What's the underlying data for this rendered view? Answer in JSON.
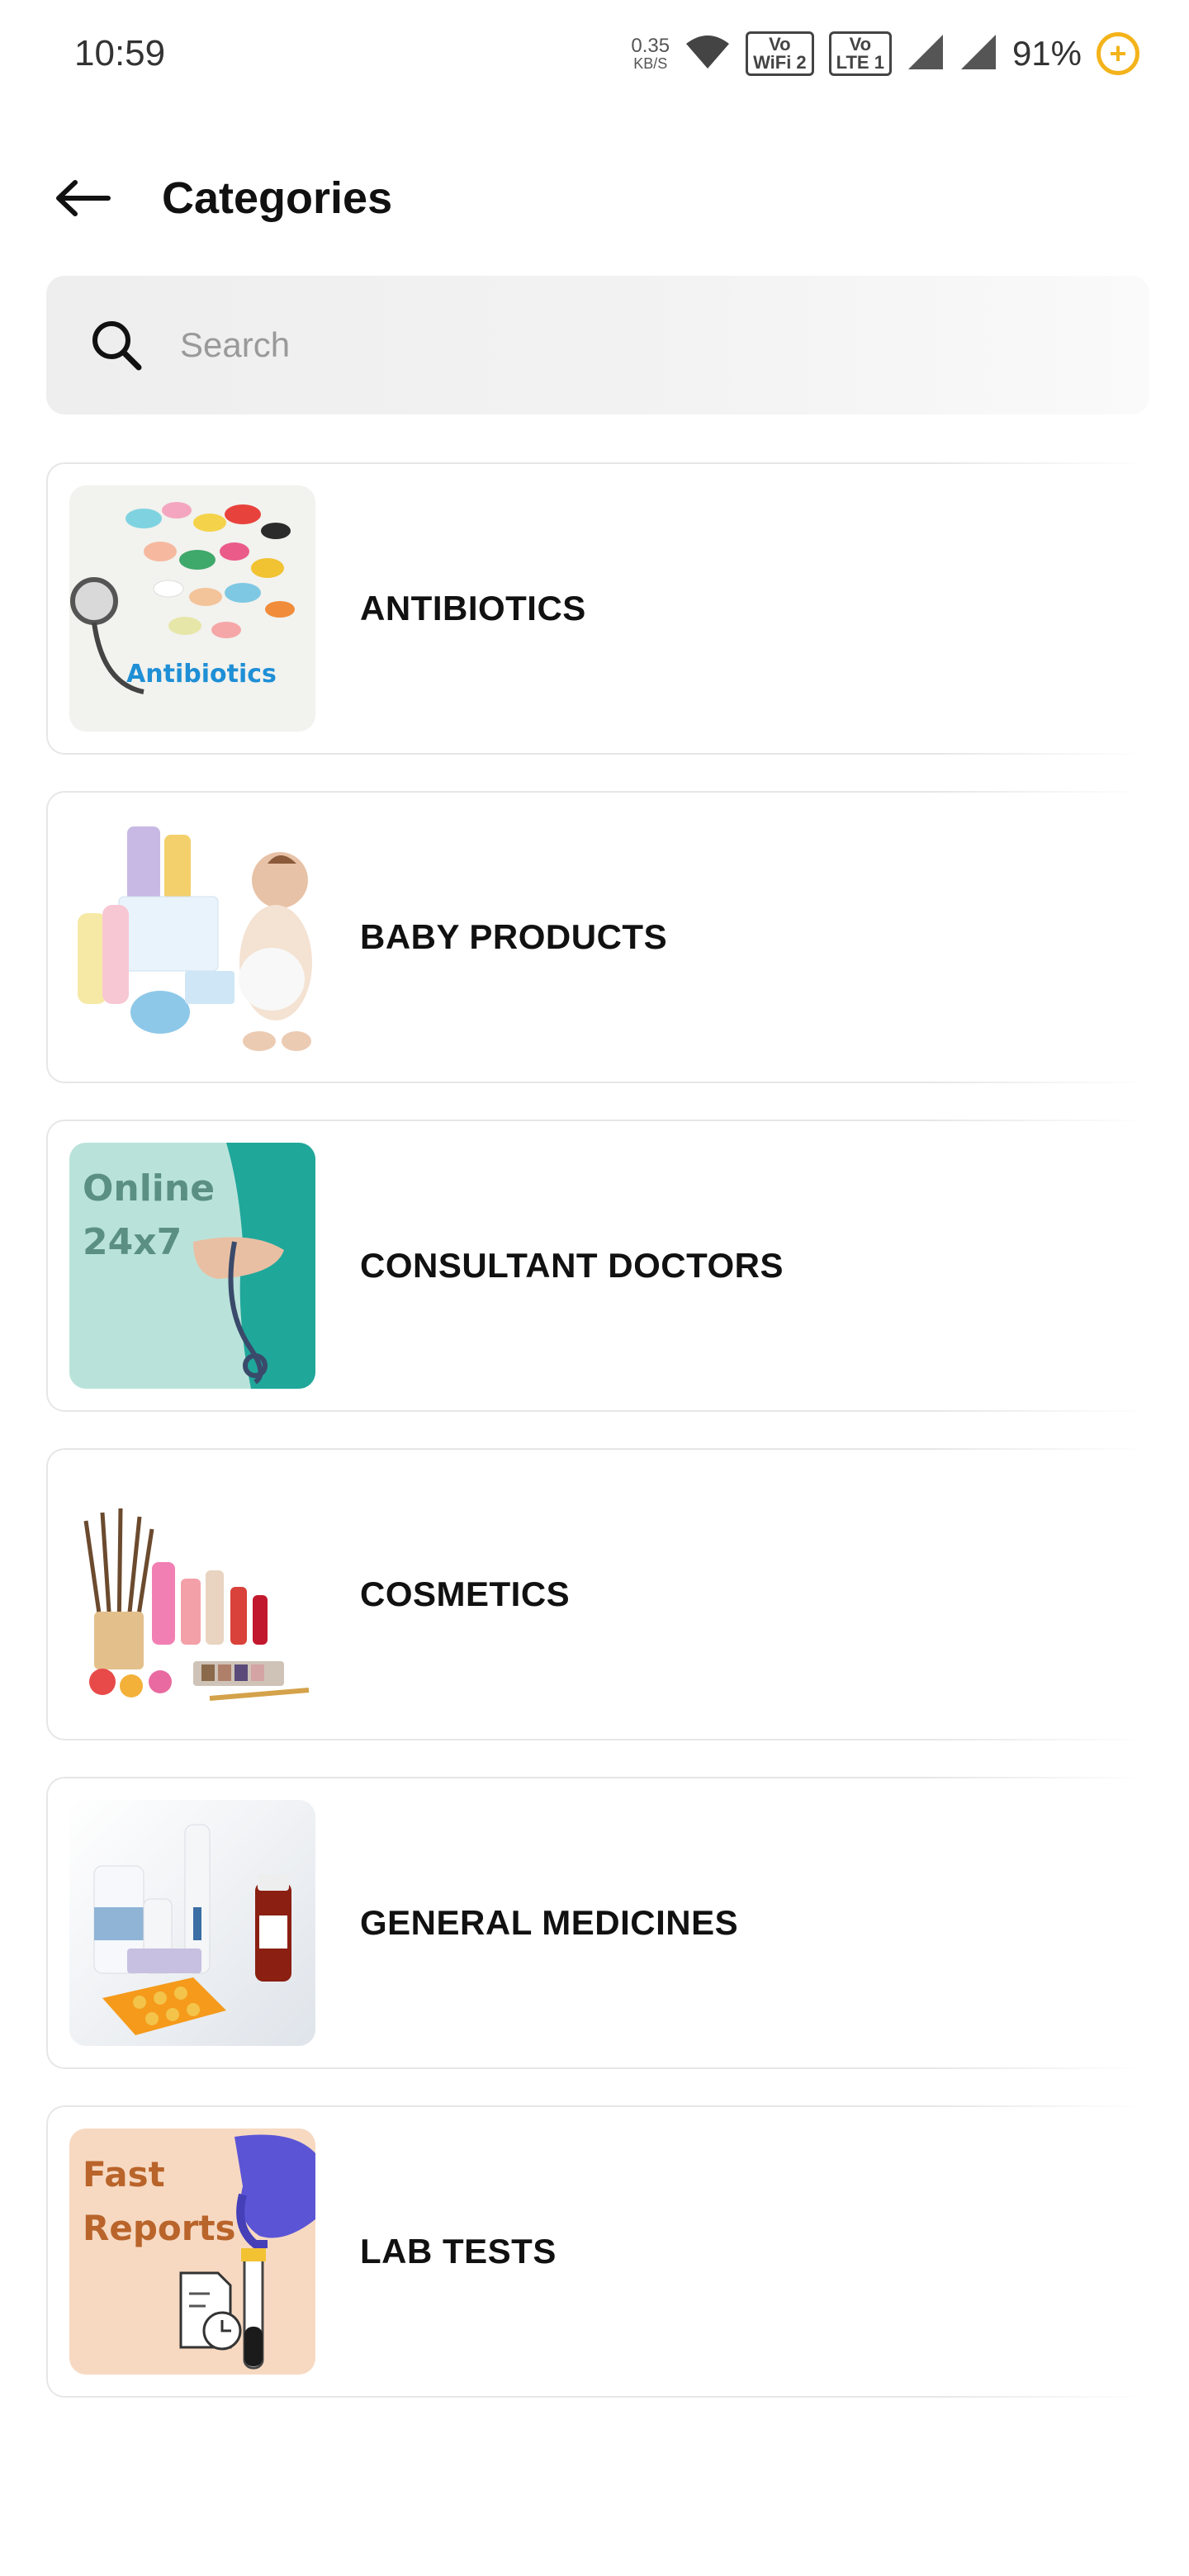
{
  "status_bar": {
    "time": "10:59",
    "net_speed_value": "0.35",
    "net_speed_unit": "KB/S",
    "wifi_badge_top": "Vo",
    "wifi_badge_bottom": "WiFi 2",
    "lte_badge_top": "Vo",
    "lte_badge_bottom": "LTE 1",
    "battery_percent": "91%",
    "battery_saver_symbol": "+"
  },
  "header": {
    "back_icon": "arrow-left-icon",
    "title": "Categories"
  },
  "search": {
    "placeholder": "Search",
    "value": "",
    "icon": "search-icon"
  },
  "categories": [
    {
      "label": "ANTIBIOTICS",
      "thumb_text": "Antibiotics"
    },
    {
      "label": "BABY PRODUCTS",
      "thumb_text": ""
    },
    {
      "label": "CONSULTANT DOCTORS",
      "thumb_text_line1": "Online",
      "thumb_text_line2": "24x7"
    },
    {
      "label": "COSMETICS",
      "thumb_text": ""
    },
    {
      "label": "GENERAL MEDICINES",
      "thumb_text": ""
    },
    {
      "label": "LAB TESTS",
      "thumb_text_line1": "Fast",
      "thumb_text_line2": "Reports"
    }
  ],
  "colors": {
    "battery_accent": "#f3b31a",
    "consult_bg": "#b9e3da",
    "consult_scrub": "#1fa79a",
    "lab_bg": "#f7d9c2",
    "lab_text": "#b9642a",
    "glove": "#5b55d6",
    "antibiotics_text": "#1f8fd6"
  }
}
